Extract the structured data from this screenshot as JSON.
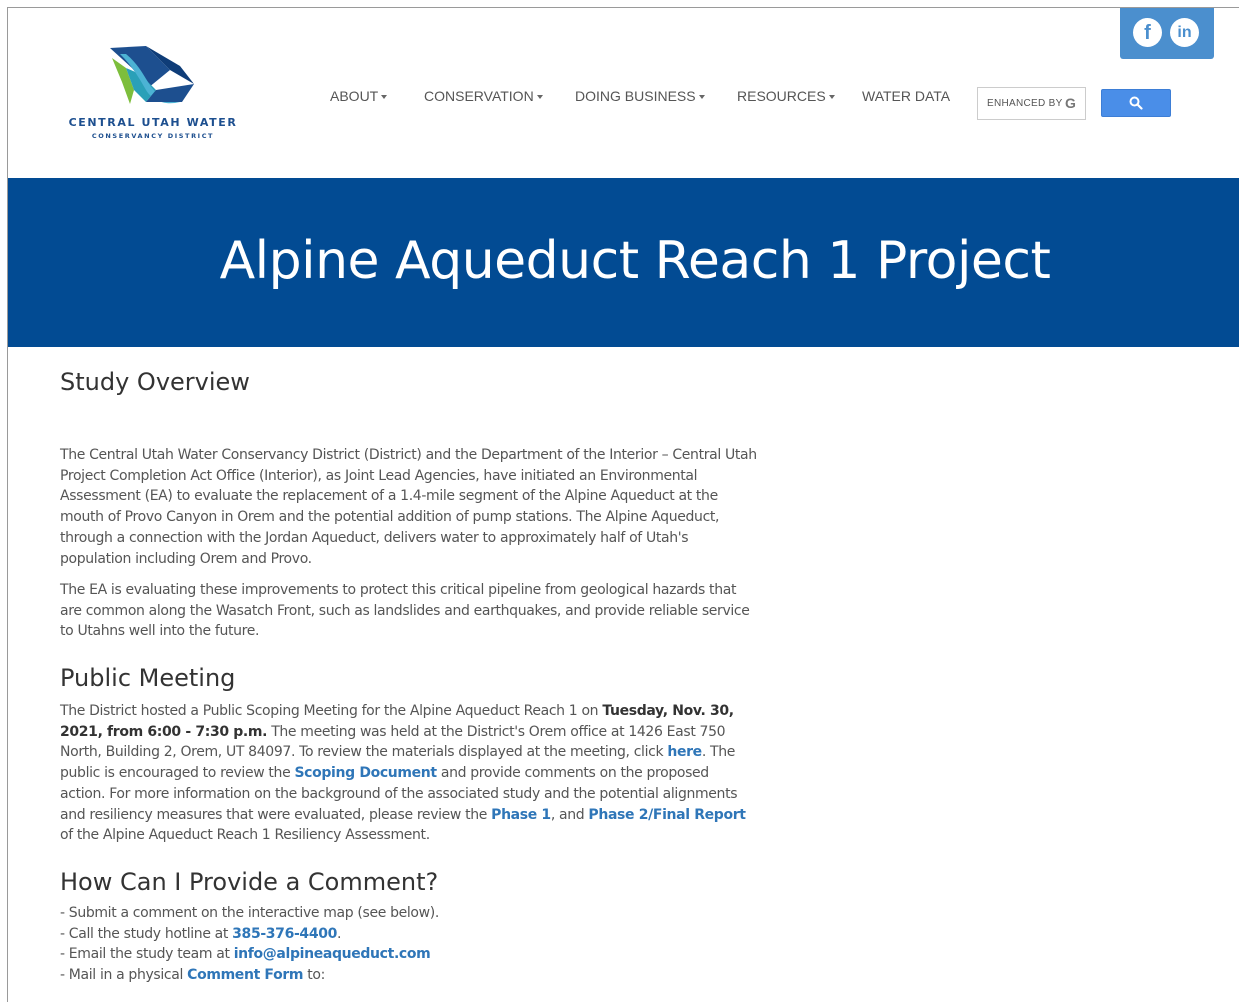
{
  "logo": {
    "line1": "CENTRAL UTAH WATER",
    "line2": "CONSERVANCY DISTRICT"
  },
  "nav": {
    "items": [
      {
        "label": "ABOUT",
        "dropdown": true
      },
      {
        "label": "CONSERVATION",
        "dropdown": true
      },
      {
        "label": "DOING BUSINESS",
        "dropdown": true
      },
      {
        "label": "RESOURCES",
        "dropdown": true
      },
      {
        "label": "WATER DATA",
        "dropdown": false
      }
    ]
  },
  "search": {
    "badge": "ENHANCED BY",
    "brand_mark": "G",
    "button_icon": "search-icon"
  },
  "social": {
    "facebook": "f",
    "linkedin": "in"
  },
  "colors": {
    "banner": "#024b93",
    "link": "#2f76b8",
    "search_button": "#4a8ee8",
    "social_bg": "#4b8fce"
  },
  "banner": {
    "title": "Alpine Aqueduct Reach 1 Project"
  },
  "overview": {
    "heading": "Study Overview",
    "p1": "The Central Utah Water Conservancy District (District) and the Department of the Interior – Central Utah Project Completion Act Office (Interior), as Joint Lead Agencies, have initiated an Environmental Assessment (EA) to evaluate the replacement of a 1.4-mile segment of the Alpine Aqueduct at the mouth of Provo Canyon in Orem and the potential addition of pump stations. The Alpine Aqueduct, through a connection with the Jordan Aqueduct, delivers water to approximately half of Utah's population including Orem and Provo.",
    "p2": "The EA is evaluating these improvements to protect this critical pipeline from geological hazards that are common along the Wasatch Front, such as landslides and earthquakes, and provide reliable service to Utahns well into the future."
  },
  "meeting": {
    "heading": "Public Meeting",
    "t1": "The District hosted a Public Scoping Meeting for the Alpine Aqueduct Reach 1 on ",
    "date_bold": "Tuesday, Nov. 30, 2021, from 6:00 - 7:30 p.m.",
    "t2": " The meeting was held at the District's Orem office at 1426 East 750 North, Building 2, Orem, UT 84097. To review the materials displayed at the meeting, click ",
    "link_here": "here",
    "t3": ". The public is encouraged to review the ",
    "link_scoping": "Scoping Document",
    "t4": " and provide comments on the proposed action. For more information on the background of the associated study and the potential alignments and resiliency measures that were evaluated, please review the ",
    "link_phase1": "Phase 1",
    "t5": ", and ",
    "link_phase2": "Phase 2/Final Report",
    "t6": " of the Alpine Aqueduct Reach 1 Resiliency Assessment."
  },
  "comment": {
    "heading": "How Can I Provide a Comment?",
    "l1": "- Submit a comment on the interactive map (see below).",
    "l2_pre": "- Call the study hotline at ",
    "l2_link": "385-376-4400",
    "l2_post": ".",
    "l3_pre": "- Email the study team at ",
    "l3_link": "info@alpineaqueduct.com",
    "l4_pre": "- Mail in a physical ",
    "l4_link": "Comment Form",
    "l4_post": " to:"
  }
}
